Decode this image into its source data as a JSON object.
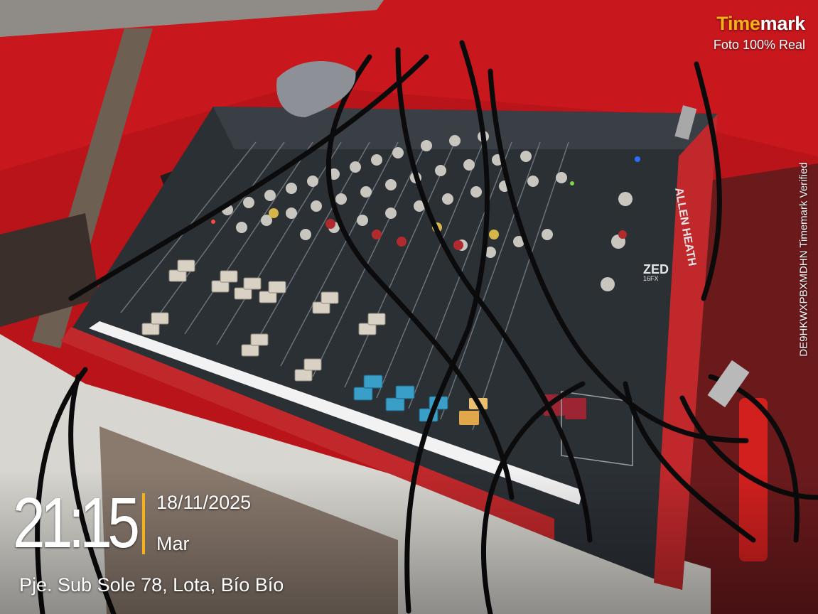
{
  "watermark": {
    "brand_time": "Time",
    "brand_mark": "mark",
    "tagline": "Foto 100% Real",
    "verified": "DE9HKWXPBXMDHN  Timemark Verified"
  },
  "stamp": {
    "time": "21:15",
    "date": "18/11/2025",
    "weekday": "Mar",
    "location": "Pje. Sub Sole 78, Lota, Bío Bío"
  },
  "mixer": {
    "brand_line1": "ALLEN",
    "brand_line2": "HEATH",
    "model": "ZED",
    "model_sub": "16FX"
  },
  "colors": {
    "accent": "#f5b11a",
    "backdrop": "#c4161a",
    "mixer_panel": "#2b3035",
    "mixer_trim": "#c0282b"
  }
}
